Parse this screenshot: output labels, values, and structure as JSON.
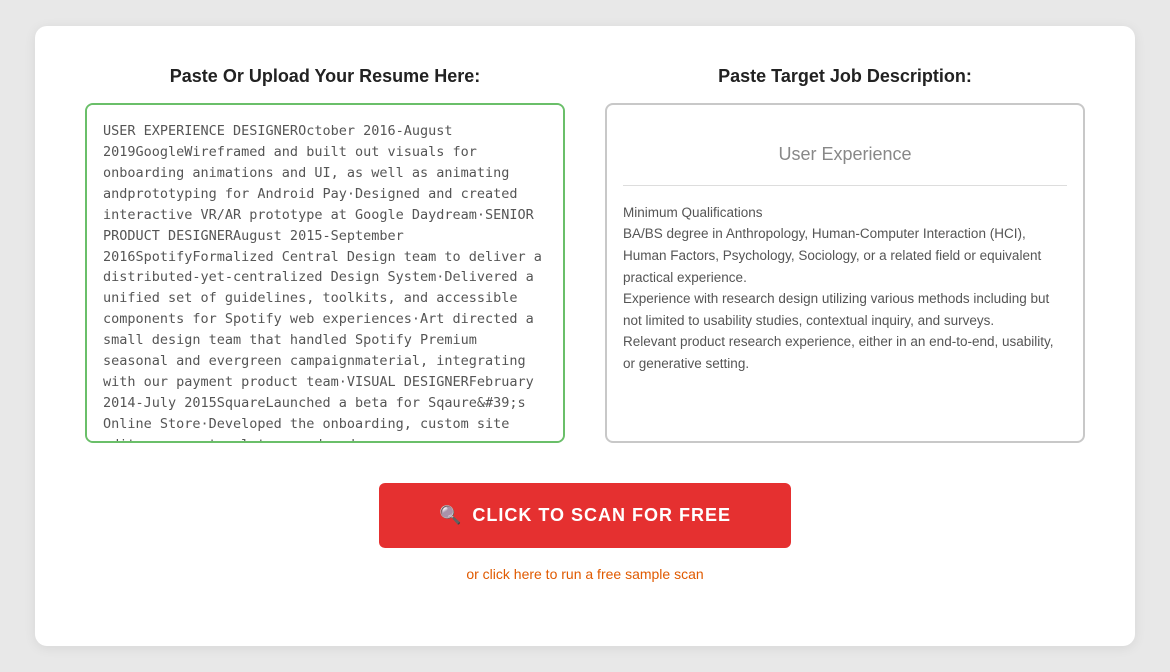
{
  "left_column": {
    "title": "Paste Or Upload Your Resume Here:",
    "content": "USER EXPERIENCE DESIGNEROctober 2016-August 2019GoogleWireframed and built out visuals for onboarding animations and UI, as well as animating andprototyping for Android Pay·Designed and created interactive VR/AR prototype at Google Daydream·SENIOR PRODUCT DESIGNERAugust 2015-September 2016SpotifyFormalized Central Design team to deliver a distributed-yet-centralized Design System·Delivered a unified set of guidelines, toolkits, and accessible components for Spotify web experiences·Art directed a small design team that handled Spotify Premium seasonal and evergreen campaignmaterial, integrating with our payment product team·VISUAL DESIGNERFebruary 2014-July 2015SquareLaunched a beta for Sqaure&#39;s Online Store·Developed the onboarding, custom site editor, page templates, and order"
  },
  "right_column": {
    "title": "Paste Target Job Description:",
    "placeholder_title": "User Experience",
    "content": "Minimum Qualifications\nBA/BS degree in Anthropology, Human-Computer Interaction (HCI), Human Factors, Psychology, Sociology, or a related field or equivalent practical experience.\nExperience with research design utilizing various methods including but not limited to usability studies, contextual inquiry, and surveys.\nRelevant product research experience, either in an end-to-end, usability, or generative setting."
  },
  "scan_button": {
    "label": "CLICK TO SCAN FOR FREE",
    "icon": "🔍"
  },
  "sample_link": {
    "label": "or click here to run a free sample scan"
  }
}
